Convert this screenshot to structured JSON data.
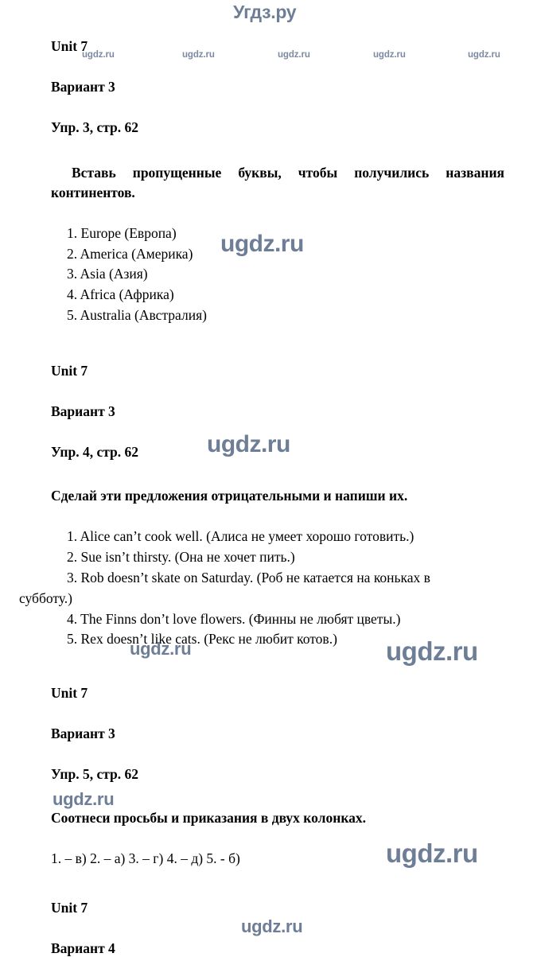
{
  "site": {
    "logo": "Угдз.ру",
    "watermark_small": "ugdz.ru",
    "watermark_large": "ugdz.ru",
    "bottom_watermark": "ugdz.ru"
  },
  "sections": [
    {
      "unit": "Unit 7",
      "variant": "Вариант 3",
      "exercise": "Упр. 3, стр. 62",
      "task": "Вставь пропущенные буквы, чтобы получились названия континентов.",
      "answers": [
        "1. Europe (Европа)",
        "2. America (Америка)",
        "3. Asia (Азия)",
        "4. Africa (Африка)",
        "5. Australia (Австралия)"
      ]
    },
    {
      "unit": "Unit 7",
      "variant": "Вариант 3",
      "exercise": "Упр. 4, стр. 62",
      "task": "Сделай эти предложения отрицательными и напиши их.",
      "answers": [
        "1. Alice can’t cook well. (Алиса не умеет хорошо готовить.)",
        "2. Sue isn’t thirsty. (Она не хочет пить.)",
        "3. Rob doesn’t skate on Saturday. (Роб не катается на коньках в",
        "субботу.)",
        "4. The Finns don’t love flowers. (Финны не любят цветы.)",
        "5. Rex doesn’t like cats. (Рекс не любит котов.)"
      ]
    },
    {
      "unit": "Unit 7",
      "variant": "Вариант 3",
      "exercise": "Упр. 5, стр. 62",
      "task": "Соотнеси просьбы и приказания в двух колонках.",
      "answers": [
        "1. – в)  2. – а)  3. – г)  4. – д)  5. - б)"
      ]
    },
    {
      "unit": "Unit 7",
      "variant": "Вариант 4"
    }
  ],
  "watermarks": {
    "header_row": [
      "ugdz.ru",
      "ugdz.ru",
      "ugdz.ru",
      "ugdz.ru",
      "ugdz.ru"
    ],
    "floating": [
      "ugdz.ru",
      "ugdz.ru",
      "ugdz.ru",
      "ugdz.ru",
      "ugdz.ru",
      "ugdz.ru",
      "ugdz.ru"
    ]
  },
  "colors": {
    "watermark": "#6e7e96",
    "text": "#000000",
    "background": "#ffffff"
  }
}
